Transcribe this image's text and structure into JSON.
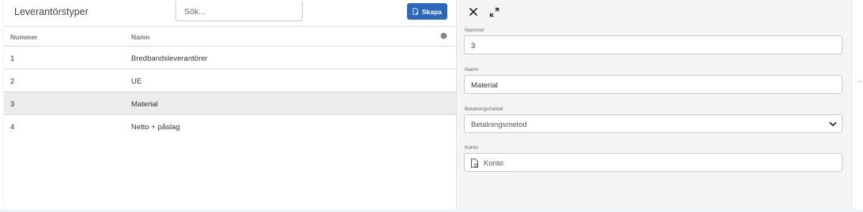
{
  "list": {
    "title": "Leverantörstyper",
    "search_placeholder": "Sök...",
    "create_label": "Skapa",
    "columns": {
      "number": "Nummer",
      "name": "Namn"
    },
    "rows": [
      {
        "number": "1",
        "name": "Bredbandsleverantörer",
        "selected": false
      },
      {
        "number": "2",
        "name": "UE",
        "selected": false
      },
      {
        "number": "3",
        "name": "Material",
        "selected": true
      },
      {
        "number": "4",
        "name": "Netto + påslag",
        "selected": false
      }
    ]
  },
  "detail": {
    "number_label": "Nummer",
    "number_value": "3",
    "name_label": "Namn",
    "name_value": "Material",
    "payment_label": "Betalningsmetod",
    "payment_value": "Betalningsmetod",
    "account_label": "Konto",
    "account_placeholder": "Konto"
  },
  "icons": {
    "close": "close-icon",
    "expand": "expand-icon",
    "gear": "gear-icon",
    "create": "file-plus-icon",
    "chevron": "chevron-down-icon",
    "account": "file-icon"
  },
  "colors": {
    "accent": "#2d67b7",
    "selected_row": "#ececec",
    "detail_background": "#f5f5f5"
  }
}
